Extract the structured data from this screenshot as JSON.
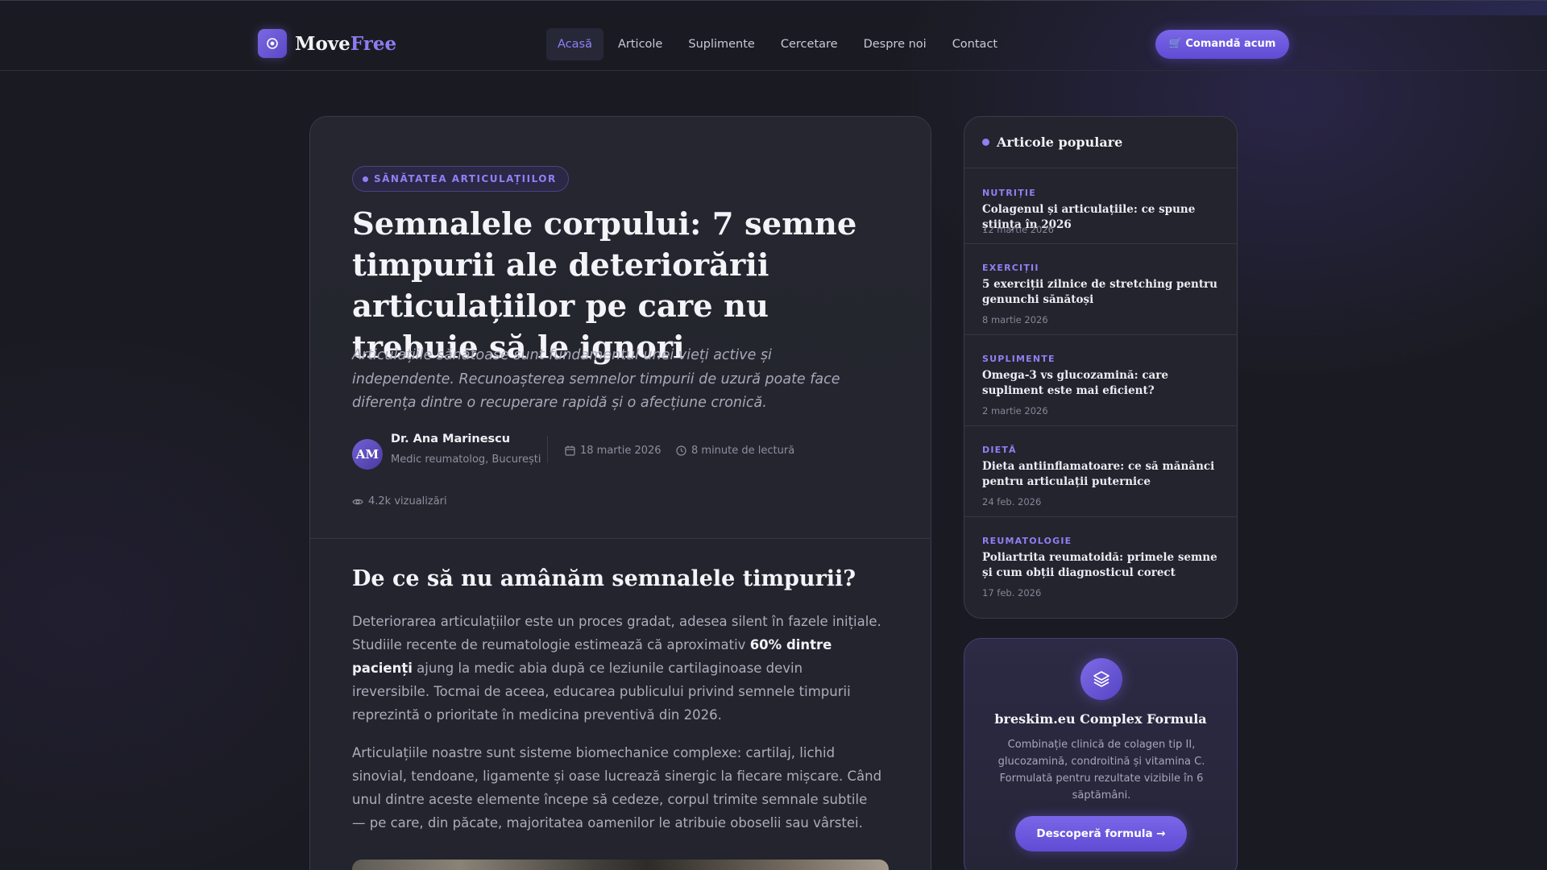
{
  "header": {
    "logo": {
      "part1": "Move",
      "part2": "Free"
    },
    "nav": [
      "Acasă",
      "Articole",
      "Suplimente",
      "Cercetare",
      "Despre noi",
      "Contact"
    ],
    "active_nav": "Acasă",
    "order_button": "🛒 Comandă acum"
  },
  "article": {
    "category": "SĂNĂTATEA ARTICULAȚIILOR",
    "title": "Semnalele corpului: 7 semne timpurii ale deteriorării articulațiilor pe care nu trebuie să le ignori",
    "subtitle": "Articulațiile sănătoase sunt fundamentul unei vieți active și independente. Recunoașterea semnelor timpurii de uzură poate face diferența dintre o recuperare rapidă și o afecțiune cronică.",
    "author": {
      "initials": "AM",
      "name": "Dr. Ana Marinescu",
      "role": "Medic reumatolog, București"
    },
    "date": "18 martie 2026",
    "read_time": "8 minute de lectură",
    "views": "4.2k vizualizări",
    "section_heading": "De ce să nu amânăm semnalele timpurii?",
    "para1_a": "Deteriorarea articulațiilor este un proces gradat, adesea silent în fazele inițiale. Studiile recente de reumatologie estimează că aproximativ ",
    "para1_bold": "60% dintre pacienți",
    "para1_b": " ajung la medic abia după ce leziunile cartilaginoase devin ireversibile. Tocmai de aceea, educarea publicului privind semnele timpurii reprezintă o prioritate în medicina preventivă din 2026.",
    "para2": "Articulațiile noastre sunt sisteme biomechanice complexe: cartilaj, lichid sinovial, tendoane, ligamente și oase lucrează sinergic la fiecare mișcare. Când unul dintre aceste elemente începe să cedeze, corpul trimite semnale subtile — pe care, din păcate, majoritatea oamenilor le atribuie oboselii sau vârstei."
  },
  "popular": {
    "heading": "Articole populare",
    "items": [
      {
        "category": "NUTRIȚIE",
        "title": "Colagenul și articulațiile: ce spune știința în 2026",
        "date": "12 martie 2026"
      },
      {
        "category": "EXERCIȚII",
        "title": "5 exerciții zilnice de stretching pentru genunchi sănătoși",
        "date": "8 martie 2026"
      },
      {
        "category": "SUPLIMENTE",
        "title": "Omega-3 vs glucozamină: care supliment este mai eficient?",
        "date": "2 martie 2026"
      },
      {
        "category": "DIETĂ",
        "title": "Dieta antiinflamatoare: ce să mănânci pentru articulații puternice",
        "date": "24 feb. 2026"
      },
      {
        "category": "REUMATOLOGIE",
        "title": "Poliartrita reumatoidă: primele semne și cum obții diagnosticul corect",
        "date": "17 feb. 2026"
      }
    ]
  },
  "promo": {
    "title": "breskim.eu Complex Formula",
    "description": "Combinație clinică de colagen tip II, glucozamină, condroitină și vitamina C. Formulată pentru rezultate vizibile în 6 săptămâni.",
    "button": "Descoperă formula →"
  },
  "colors": {
    "accent": "#8f80f5",
    "background": "#1a1b22",
    "card": "#23242d"
  }
}
